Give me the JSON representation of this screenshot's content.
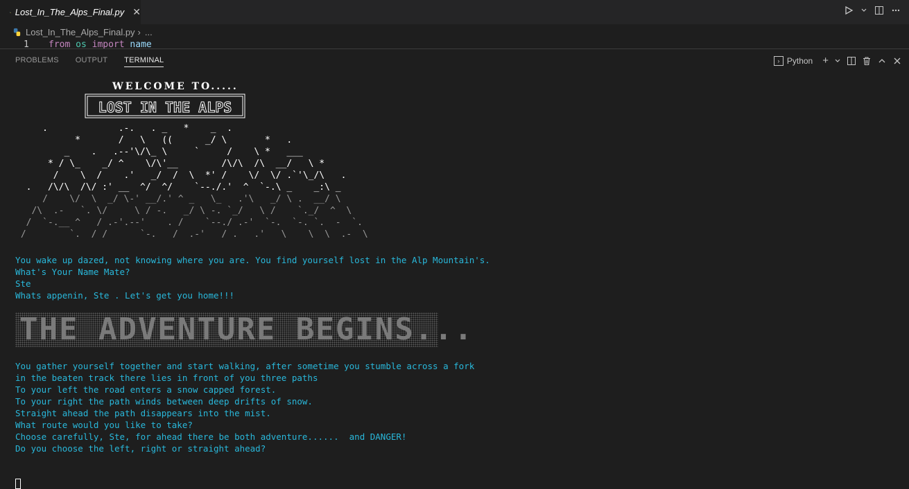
{
  "editor": {
    "tab_label": "Lost_In_The_Alps_Final.py",
    "tab_close": "✕",
    "breadcrumb_file": "Lost_In_The_Alps_Final.py",
    "breadcrumb_sep": "›",
    "breadcrumb_more": "...",
    "line_number": "1",
    "code": {
      "kw1": "from",
      "mod": "os",
      "kw2": "import",
      "name": "name"
    }
  },
  "panel": {
    "tabs": [
      "PROBLEMS",
      "OUTPUT",
      "TERMINAL"
    ],
    "active_tab": "TERMINAL",
    "shell_label": "Python"
  },
  "terminal": {
    "welcome": "WELCOME TO.....",
    "logo_text": "LOST IN THE ALPS",
    "lines_a": [
      "You wake up dazed, not knowing where you are. You find yourself lost in the Alp Mountain's.",
      "What's Your Name Mate?",
      "Ste",
      "Whats appenin, Ste . Let's get you home!!!"
    ],
    "banner": "THE ADVENTURE BEGINS...",
    "lines_b": [
      "You gather yourself together and start walking, after sometime you stumble across a fork",
      "in the beaten track there lies in front of you three paths",
      "To your left the road enters a snow capped forest.",
      "To your right the path winds between deep drifts of snow.",
      "Straight ahead the path disappears into the mist.",
      "What route would you like to take?",
      "Choose carefully, Ste, for ahead there be both adventure......  and DANGER!",
      "Do you choose the left, right or straight ahead?"
    ]
  },
  "colors": {
    "accent_text": "#29b8db",
    "background": "#1e1e1e"
  }
}
